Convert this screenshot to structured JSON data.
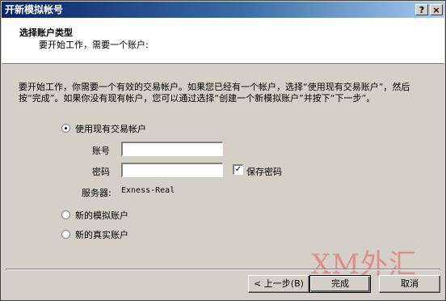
{
  "window": {
    "title": "开新模拟帐号",
    "help_button": "?",
    "close_button": "×"
  },
  "header": {
    "title": "选择账户类型",
    "subtitle": "要开始工作，需要一个账户:"
  },
  "intro_text": "要开始工作，你需要一个有效的交易帐户。如果您已经有一个帐户，选择“使用现有交易账户”，然后按“完成”。如果你没有现有帐户，您可以通过选择“创建一个新模拟账户”并按下“下一步”。",
  "options": {
    "existing": {
      "label": "使用现有交易帐户",
      "selected": true
    },
    "demo": {
      "label": "新的模拟账户",
      "selected": false
    },
    "real": {
      "label": "新的真实账户",
      "selected": false
    }
  },
  "form": {
    "account_label": "账号",
    "account_value": "",
    "password_label": "密码",
    "password_value": "",
    "save_password_label": "保存密码",
    "save_password_checked": true,
    "server_label": "服务器:",
    "server_value": "Exness-Real"
  },
  "buttons": {
    "back": "< 上一步(B)",
    "finish": "完成",
    "cancel": "取消"
  },
  "watermark": "XM外汇"
}
